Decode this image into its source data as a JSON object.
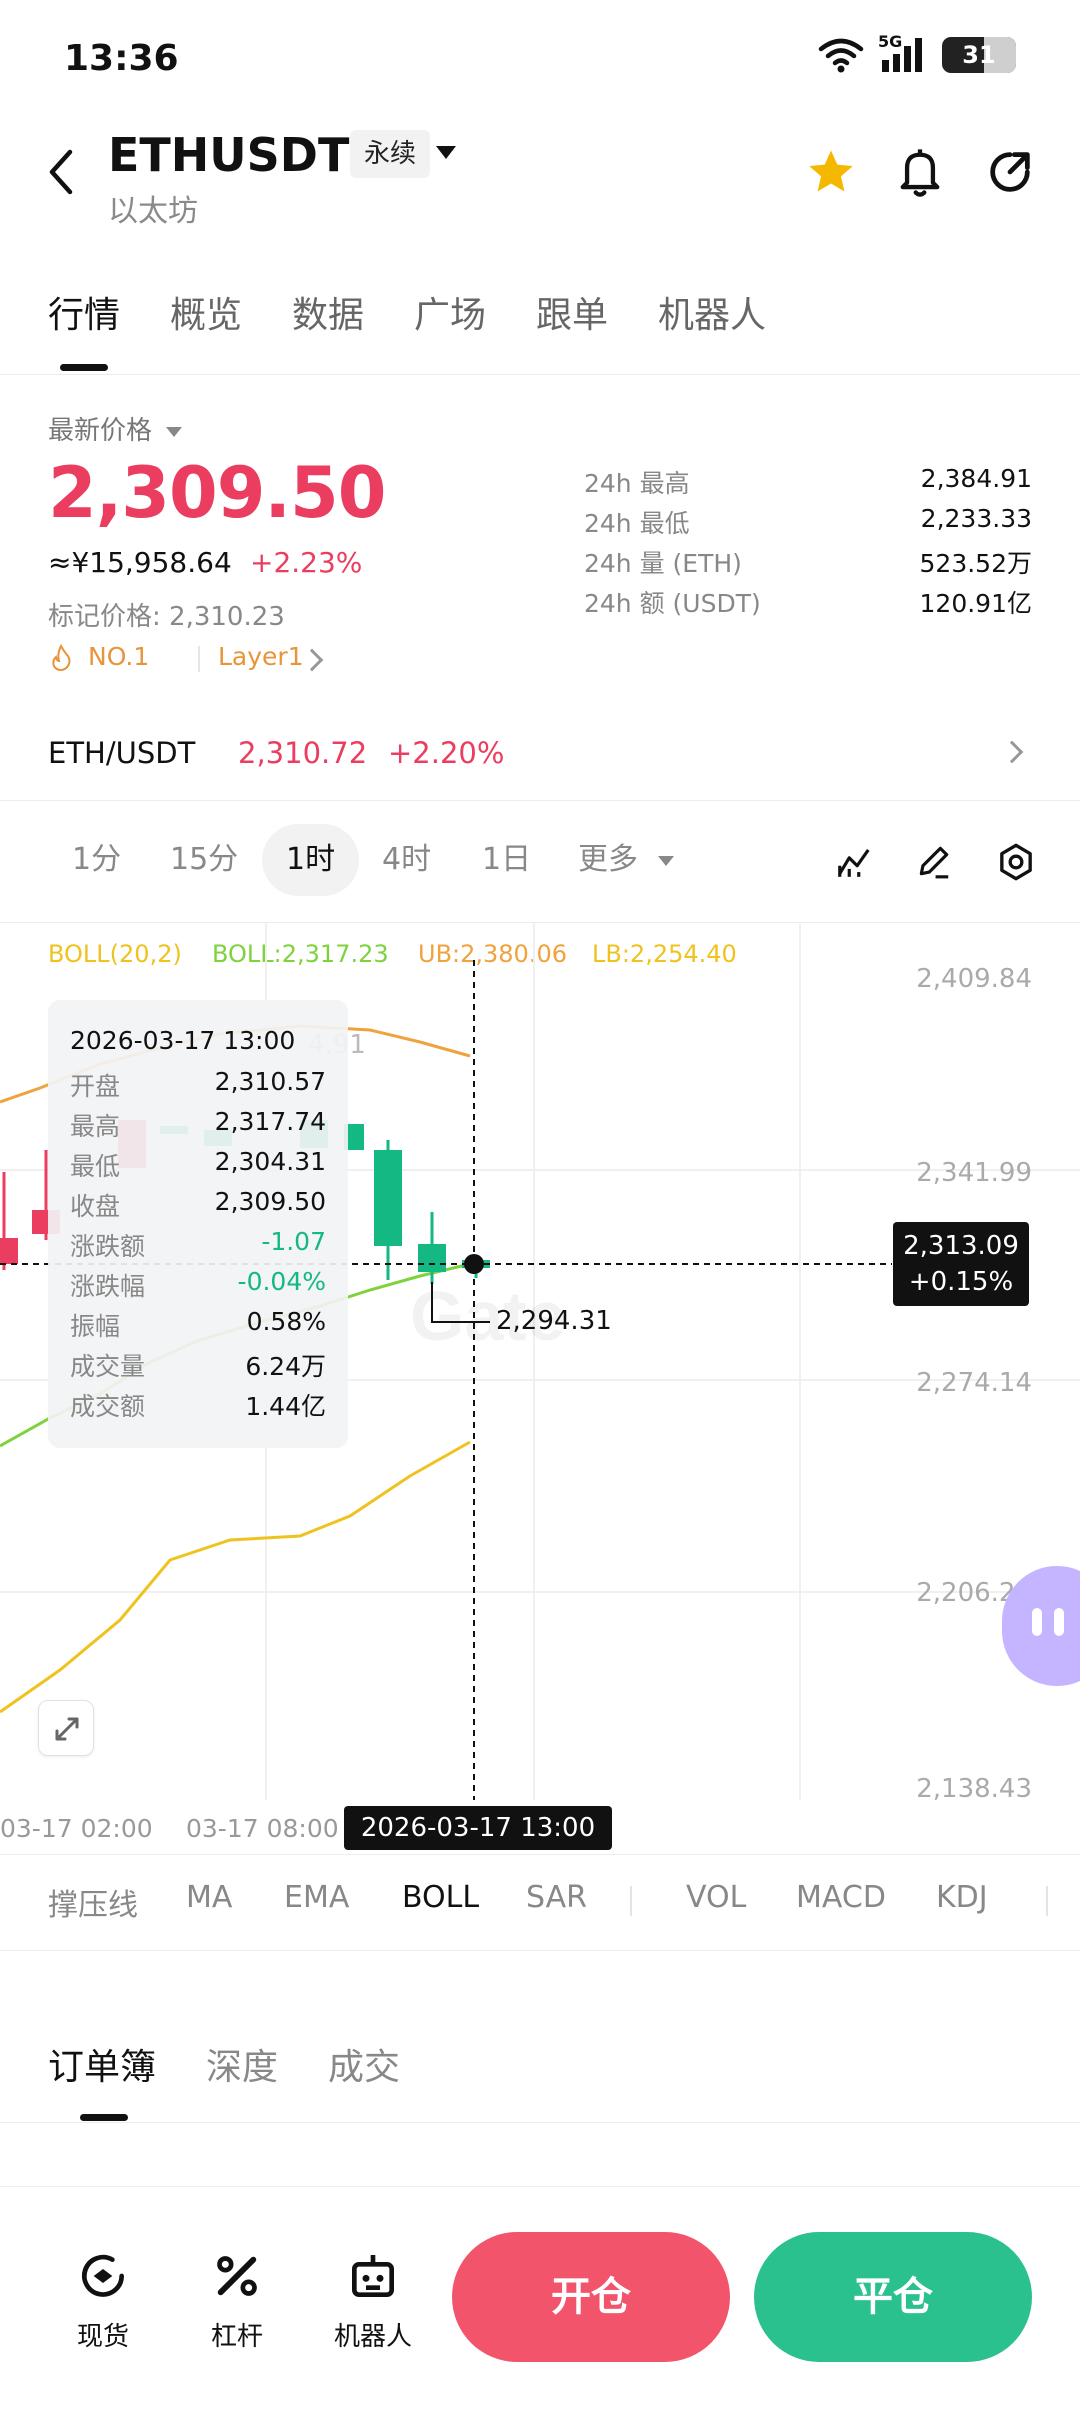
{
  "status": {
    "time": "13:36",
    "network": "5G",
    "battery": "31"
  },
  "header": {
    "symbol": "ETHUSDT",
    "type": "永续",
    "name": "以太坊"
  },
  "tabs": [
    "行情",
    "概览",
    "数据",
    "广场",
    "跟单",
    "机器人"
  ],
  "price": {
    "label": "最新价格",
    "last": "2,309.50",
    "cny": "≈¥15,958.64",
    "change": "+2.23%",
    "mark": "标记价格: 2,310.23",
    "tag_rank": "NO.1",
    "tag_sector": "Layer1"
  },
  "stats": [
    {
      "label": "24h  最高",
      "value": "2,384.91"
    },
    {
      "label": "24h  最低",
      "value": "2,233.33"
    },
    {
      "label": "24h  量 (ETH)",
      "value": "523.52万"
    },
    {
      "label": "24h  额 (USDT)",
      "value": "120.91亿"
    }
  ],
  "spot_pair": {
    "name": "ETH/USDT",
    "price": "2,310.72",
    "change": "+2.20%"
  },
  "timeframes": [
    "1分",
    "15分",
    "1时",
    "4时",
    "1日",
    "更多"
  ],
  "active_timeframe": "1时",
  "boll": {
    "params": "BOLL(20,2)",
    "mid": "BOLL:2,317.23",
    "ub": "UB:2,380.06",
    "lb": "LB:2,254.40"
  },
  "tooltip": {
    "datetime": "2026-03-17 13:00",
    "rows": [
      {
        "k": "开盘",
        "v": "2,310.57"
      },
      {
        "k": "最高",
        "v": "2,317.74"
      },
      {
        "k": "最低",
        "v": "2,304.31"
      },
      {
        "k": "收盘",
        "v": "2,309.50"
      },
      {
        "k": "涨跌额",
        "v": "-1.07"
      },
      {
        "k": "涨跌幅",
        "v": "-0.04%"
      },
      {
        "k": "振幅",
        "v": "0.58%"
      },
      {
        "k": "成交量",
        "v": "6.24万"
      },
      {
        "k": "成交额",
        "v": "1.44亿"
      }
    ]
  },
  "y_axis": [
    "2,409.84",
    "2,341.99",
    "2,274.14",
    "2,206.29",
    "2,138.43"
  ],
  "x_axis": [
    "03-17 02:00",
    "03-17 08:00"
  ],
  "crosshair": {
    "price": "2,313.09",
    "change": "+0.15%",
    "time": "2026-03-17 13:00",
    "low_marker": "2,294.31",
    "high_marker_partial": "4.91"
  },
  "watermark": "Gate",
  "indicators": [
    "撑压线",
    "MA",
    "EMA",
    "BOLL",
    "SAR",
    "VOL",
    "MACD",
    "KDJ"
  ],
  "active_indicator": "BOLL",
  "book_tabs": [
    "订单簿",
    "深度",
    "成交"
  ],
  "bottom_nav": [
    "现货",
    "杠杆",
    "机器人"
  ],
  "actions": {
    "open": "开仓",
    "close": "平仓"
  },
  "colors": {
    "up": "#ea3d5f",
    "down": "#14b883",
    "ub": "#f0a23c",
    "mid": "#7ed33c",
    "lb": "#f0c21e"
  }
}
